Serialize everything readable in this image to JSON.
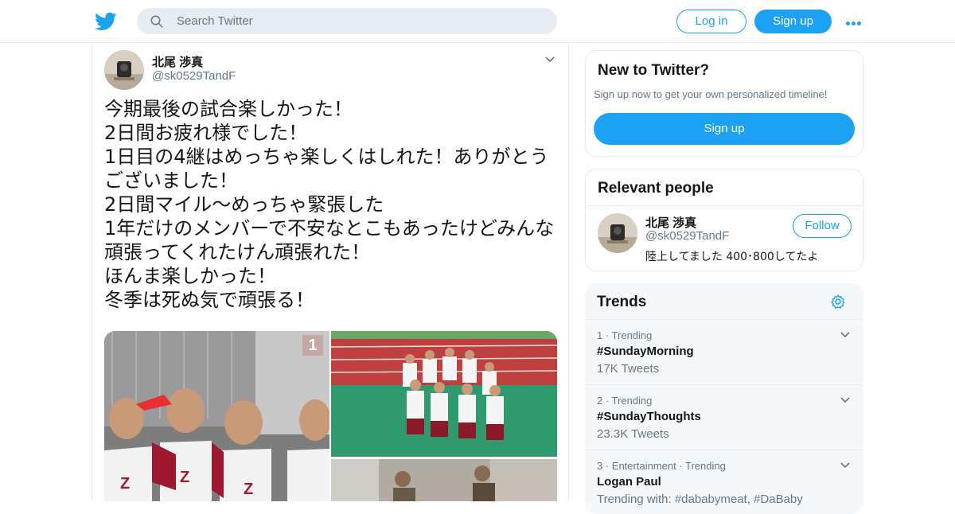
{
  "header": {
    "search_placeholder": "Search Twitter",
    "login_label": "Log in",
    "signup_label": "Sign up",
    "brand_color": "#1da1f2"
  },
  "tweet": {
    "author_name": "北尾 渉真",
    "author_handle": "@sk0529TandF",
    "text": "今期最後の試合楽しかった！\n2日間お疲れ様でした！\n1日目の4継はめっちゃ楽しくはしれた！ありがとう\nございました！\n2日間マイル〜めっちゃ緊張した\n1年だけのメンバーで不安なとこもあったけどみんな\n頑張ってくれたけん頑張れた！\nほんま楽しかった！\n冬季は死ぬ気で頑張る！",
    "media_badge": "1"
  },
  "sidebar": {
    "new_to_twitter": {
      "title": "New to Twitter?",
      "subtitle": "Sign up now to get your own personalized timeline!",
      "cta": "Sign up"
    },
    "relevant_people": {
      "title": "Relevant people",
      "person": {
        "name": "北尾 渉真",
        "handle": "@sk0529TandF",
        "follow_label": "Follow",
        "bio": "陸上してました 400･800してたよ"
      }
    },
    "trends": {
      "title": "Trends",
      "items": [
        {
          "meta": "1 · Trending",
          "name": "#SundayMorning",
          "count": "17K Tweets"
        },
        {
          "meta": "2 · Trending",
          "name": "#SundayThoughts",
          "count": "23.3K Tweets"
        },
        {
          "meta": "3 · Entertainment · Trending",
          "name": "Logan Paul",
          "count": "Trending with: #dababymeat, #DaBaby"
        }
      ]
    }
  }
}
